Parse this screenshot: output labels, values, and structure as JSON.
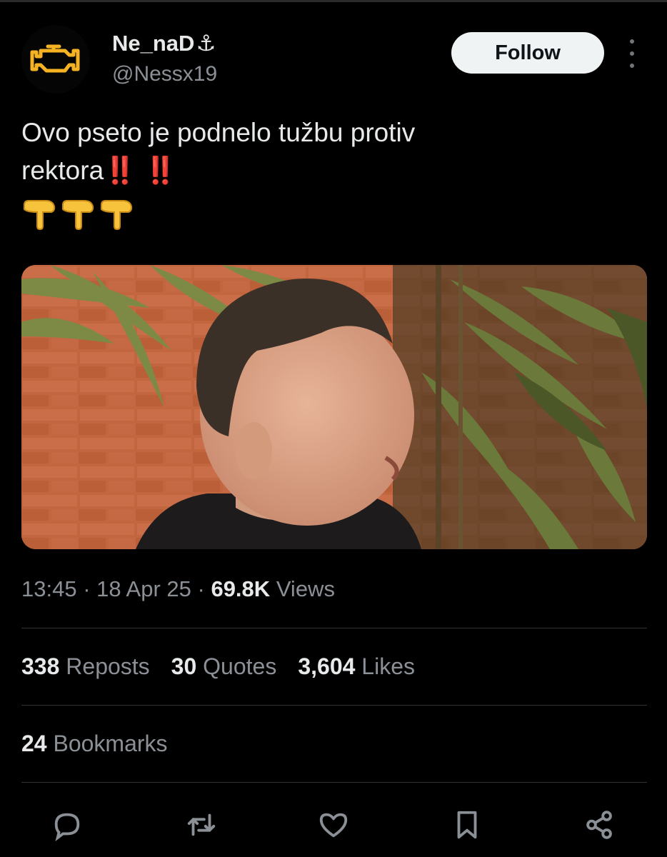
{
  "author": {
    "display_name": "Ne_naD",
    "name_emoji": "⚓",
    "handle": "@Nessx19",
    "avatar_icon": "check-engine-icon"
  },
  "header": {
    "follow_label": "Follow",
    "more_icon": "more-vertical-icon"
  },
  "tweet": {
    "line1": "Ovo pseto je podnelo tužbu protiv",
    "line2_text": "rektora",
    "line2_emoji": "‼️ ‼️",
    "line3_emoji": "👇👇👇"
  },
  "media": {
    "kind": "video-still"
  },
  "meta": {
    "time": "13:45",
    "date": "18 Apr 25",
    "views_count": "69.8K",
    "views_label": "Views",
    "separator": "·"
  },
  "stats": {
    "reposts_count": "338",
    "reposts_label": "Reposts",
    "quotes_count": "30",
    "quotes_label": "Quotes",
    "likes_count": "3,604",
    "likes_label": "Likes",
    "bookmarks_count": "24",
    "bookmarks_label": "Bookmarks"
  },
  "actions": [
    {
      "icon": "reply-icon"
    },
    {
      "icon": "repost-icon"
    },
    {
      "icon": "like-icon"
    },
    {
      "icon": "bookmark-icon"
    },
    {
      "icon": "share-icon"
    }
  ],
  "colors": {
    "background": "#000000",
    "text_primary": "#e7e9ea",
    "text_secondary": "#8b9096",
    "divider": "#2f3336",
    "follow_bg": "#eff3f4",
    "avatar_icon": "#f5b324"
  }
}
